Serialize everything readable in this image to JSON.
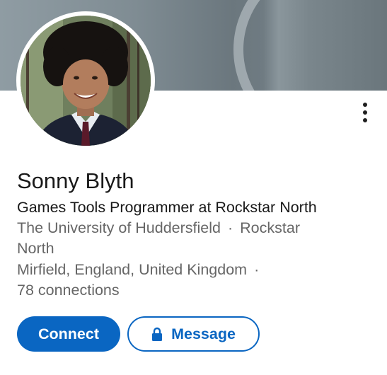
{
  "profile": {
    "name": "Sonny Blyth",
    "headline": "Games Tools Programmer at Rockstar North",
    "education": "The University of Huddersfield",
    "separator": "·",
    "company_line1": "Rockstar",
    "company_line2": "North",
    "location": "Mirfield, England, United Kingdom",
    "connections": "78 connections"
  },
  "actions": {
    "connect_label": "Connect",
    "message_label": "Message"
  },
  "icons": {
    "more": "more-vertical-icon",
    "lock": "lock-icon"
  },
  "colors": {
    "primary": "#0a66c2",
    "text": "#191919",
    "secondary_text": "#666666"
  }
}
